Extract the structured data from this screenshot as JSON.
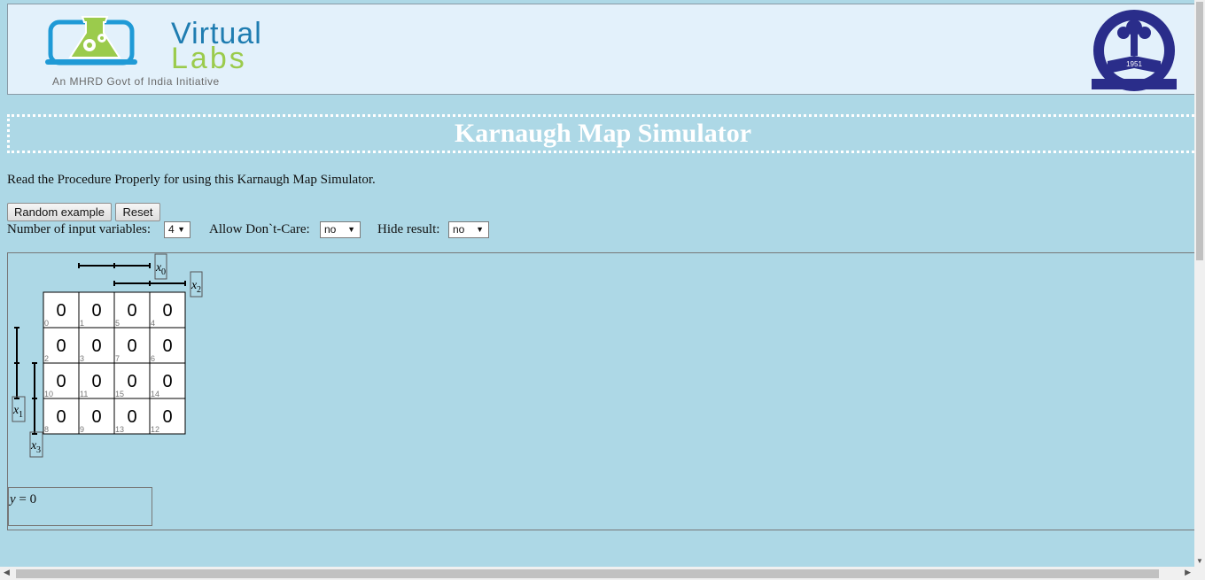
{
  "header": {
    "logo_virtual": "Virtual",
    "logo_labs": "Labs",
    "logo_tagline": "An MHRD Govt of India Initiative",
    "iit_year": "1951"
  },
  "page": {
    "title": "Karnaugh Map Simulator",
    "instructions": "Read the Procedure Properly for using this Karnaugh Map Simulator."
  },
  "buttons": {
    "random": "Random example",
    "reset": "Reset"
  },
  "controls": {
    "num_vars_label": "Number of input variables:",
    "num_vars_value": "4",
    "dont_care_label": "Allow Don`t-Care:",
    "dont_care_value": "no",
    "hide_result_label": "Hide result:",
    "hide_result_value": "no"
  },
  "kmap": {
    "var_labels": {
      "x0": {
        "base": "x",
        "sub": "0"
      },
      "x2": {
        "base": "x",
        "sub": "2"
      },
      "x1": {
        "base": "x",
        "sub": "1"
      },
      "x3": {
        "base": "x",
        "sub": "3"
      }
    },
    "cells": [
      [
        {
          "value": "0",
          "index": "0"
        },
        {
          "value": "0",
          "index": "1"
        },
        {
          "value": "0",
          "index": "5"
        },
        {
          "value": "0",
          "index": "4"
        }
      ],
      [
        {
          "value": "0",
          "index": "2"
        },
        {
          "value": "0",
          "index": "3"
        },
        {
          "value": "0",
          "index": "7"
        },
        {
          "value": "0",
          "index": "6"
        }
      ],
      [
        {
          "value": "0",
          "index": "10"
        },
        {
          "value": "0",
          "index": "11"
        },
        {
          "value": "0",
          "index": "15"
        },
        {
          "value": "0",
          "index": "14"
        }
      ],
      [
        {
          "value": "0",
          "index": "8"
        },
        {
          "value": "0",
          "index": "9"
        },
        {
          "value": "0",
          "index": "13"
        },
        {
          "value": "0",
          "index": "12"
        }
      ]
    ]
  },
  "result": {
    "var": "y",
    "expression": " = 0"
  }
}
